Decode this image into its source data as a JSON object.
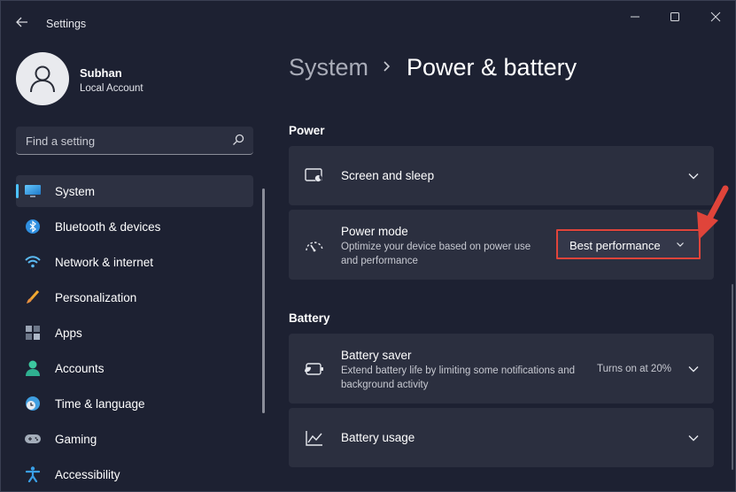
{
  "app": {
    "title": "Settings"
  },
  "user": {
    "name": "Subhan",
    "account_type": "Local Account"
  },
  "search": {
    "placeholder": "Find a setting"
  },
  "sidebar": {
    "items": [
      {
        "label": "System",
        "icon": "system-icon",
        "active": true
      },
      {
        "label": "Bluetooth & devices",
        "icon": "bluetooth-icon"
      },
      {
        "label": "Network & internet",
        "icon": "wifi-icon"
      },
      {
        "label": "Personalization",
        "icon": "brush-icon"
      },
      {
        "label": "Apps",
        "icon": "apps-icon"
      },
      {
        "label": "Accounts",
        "icon": "accounts-icon"
      },
      {
        "label": "Time & language",
        "icon": "globe-clock-icon"
      },
      {
        "label": "Gaming",
        "icon": "gamepad-icon"
      },
      {
        "label": "Accessibility",
        "icon": "accessibility-icon"
      }
    ]
  },
  "breadcrumb": {
    "root": "System",
    "page": "Power & battery"
  },
  "power": {
    "section_title": "Power",
    "screen_sleep": {
      "title": "Screen and sleep",
      "icon": "screen-sleep-icon"
    },
    "power_mode": {
      "title": "Power mode",
      "description": "Optimize your device based on power use and performance",
      "selected": "Best performance",
      "icon": "gauge-icon"
    }
  },
  "battery": {
    "section_title": "Battery",
    "saver": {
      "title": "Battery saver",
      "description": "Extend battery life by limiting some notifications and background activity",
      "status": "Turns on at 20%",
      "icon": "battery-saver-icon"
    },
    "usage": {
      "title": "Battery usage",
      "icon": "chart-line-icon"
    }
  },
  "colors": {
    "accent": "#4cc2ff",
    "highlight": "#e0443a",
    "background": "#1d2132",
    "card": "#2b2f3f"
  }
}
